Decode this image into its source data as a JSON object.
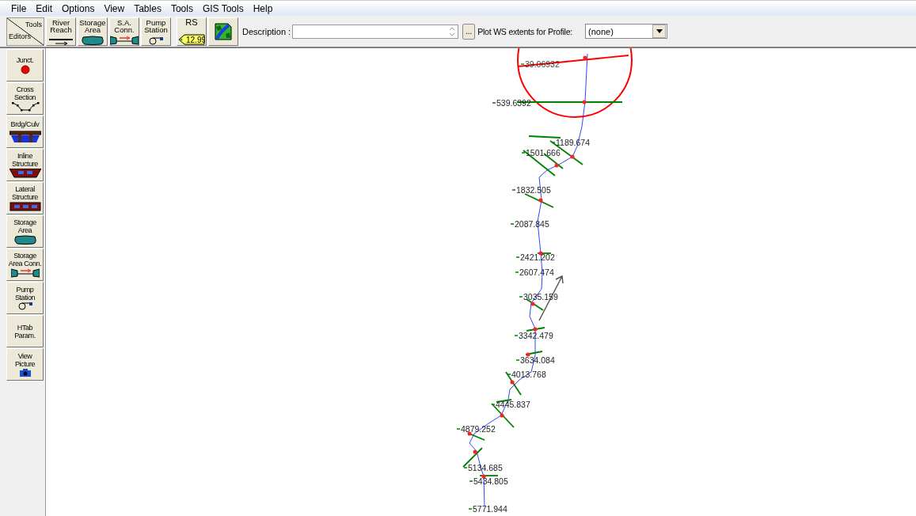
{
  "menu": [
    "File",
    "Edit",
    "Options",
    "View",
    "Tables",
    "Tools",
    "GIS Tools",
    "Help"
  ],
  "toolbar": {
    "corner": {
      "top": "Tools",
      "bottom": "Editors"
    },
    "tools": [
      {
        "label": "River\nReach",
        "kind": "reach"
      },
      {
        "label": "Storage\nArea",
        "kind": "storage"
      },
      {
        "label": "S.A.\nConn.",
        "kind": "connection"
      },
      {
        "label": "Pump\nStation",
        "kind": "pump"
      }
    ],
    "rs": {
      "label": "RS",
      "value": "12.99"
    },
    "description": {
      "label": "Description :"
    },
    "browse": "...",
    "profile": {
      "label": "Plot WS extents for Profile:",
      "value": "(none)"
    }
  },
  "sidebar": [
    {
      "label": "Junct.",
      "kind": "junction"
    },
    {
      "label": "Cross\nSection",
      "kind": "cross"
    },
    {
      "label": "Brdg/Culv",
      "kind": "bridge"
    },
    {
      "label": "Inline\nStructure",
      "kind": "inline"
    },
    {
      "label": "Lateral\nStructure",
      "kind": "lateral"
    },
    {
      "label": "Storage\nArea",
      "kind": "storage"
    },
    {
      "label": "Storage\nArea Conn.",
      "kind": "connection"
    },
    {
      "label": "Pump\nStation",
      "kind": "pump"
    },
    {
      "label": "HTab\nParam.",
      "kind": "text"
    },
    {
      "label": "View\nPicture",
      "kind": "camera"
    }
  ],
  "map": {
    "sections": [
      {
        "label": "39.06932",
        "selected": true
      },
      {
        "label": "539.6392",
        "selected": false
      },
      {
        "label": "1189.674",
        "selected": false
      },
      {
        "label": "1501.666",
        "selected": false
      },
      {
        "label": "1832.505",
        "selected": false
      },
      {
        "label": "2087.845",
        "selected": false
      },
      {
        "label": "2421.202",
        "selected": false
      },
      {
        "label": "2607.474",
        "selected": false
      },
      {
        "label": "3035.159",
        "selected": false
      },
      {
        "label": "3342.479",
        "selected": false
      },
      {
        "label": "3634.084",
        "selected": false
      },
      {
        "label": "4013.768",
        "selected": false
      },
      {
        "label": "4445.837",
        "selected": false
      },
      {
        "label": "4879.252",
        "selected": false
      },
      {
        "label": "5134.685",
        "selected": false
      },
      {
        "label": "5434.805",
        "selected": false
      },
      {
        "label": "5771.944",
        "selected": false
      }
    ]
  }
}
